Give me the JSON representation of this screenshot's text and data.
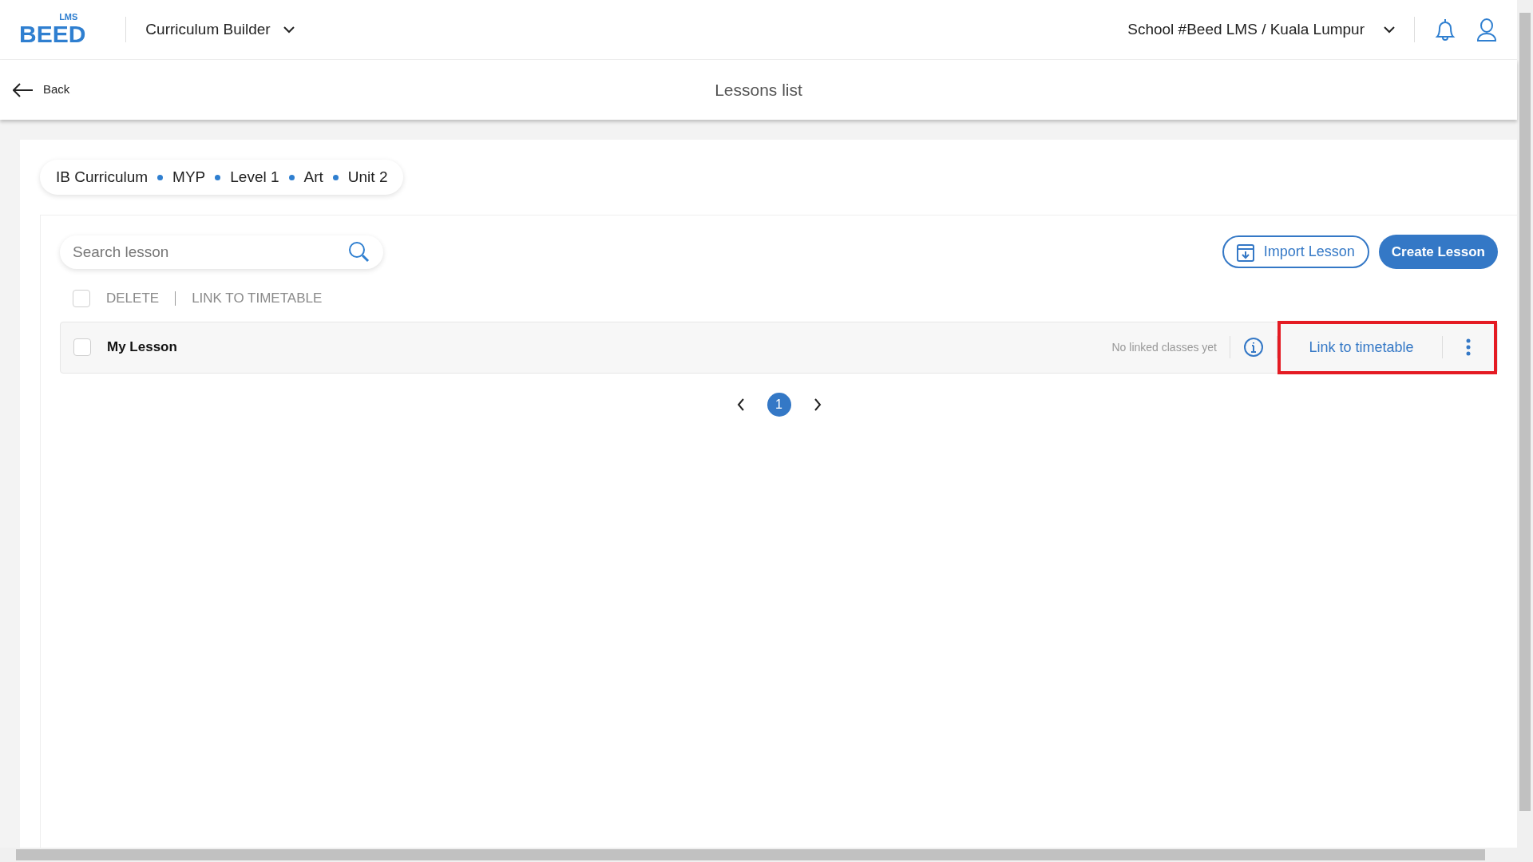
{
  "header": {
    "logo": {
      "mark": "BEED",
      "tag": "LMS"
    },
    "module": "Curriculum Builder",
    "school": "School #Beed LMS / Kuala Lumpur"
  },
  "subheader": {
    "back": "Back",
    "title": "Lessons list"
  },
  "breadcrumb": [
    "IB Curriculum",
    "MYP",
    "Level 1",
    "Art",
    "Unit 2"
  ],
  "search": {
    "placeholder": "Search lesson"
  },
  "buttons": [
    {
      "kind": "outline",
      "label": "Import Lesson"
    },
    {
      "kind": "filled",
      "label": "Create Lesson"
    }
  ],
  "bulk": {
    "checked": false,
    "actions": [
      "DELETE",
      "LINK TO TIMETABLE"
    ]
  },
  "lessons": [
    {
      "title": "My Lesson",
      "checked": false,
      "status": "No linked classes yet",
      "action": "Link to timetable",
      "highlighted": true
    }
  ],
  "pagination": {
    "pages": [
      {
        "label": "1",
        "selected": true
      }
    ]
  }
}
